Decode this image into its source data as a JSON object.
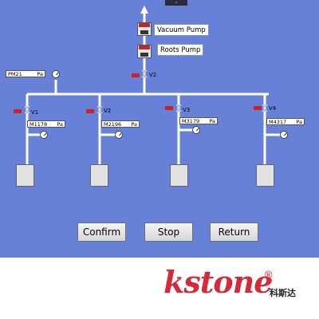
{
  "top_tab": "⌄",
  "pumps": {
    "vacuum_label": "Vacuum Pump",
    "roots_label": "Roots Pump"
  },
  "main_gauge": {
    "value": "PM21",
    "unit": "Pa"
  },
  "valve_v2_top": "V2",
  "branches": [
    {
      "valve": "V1",
      "readout": "M1",
      "value": "178",
      "unit": "Pa"
    },
    {
      "valve": "V2",
      "readout": "M2",
      "value": "196",
      "unit": "Pa"
    },
    {
      "valve": "V3",
      "readout": "M3",
      "value": "179",
      "unit": "Pa"
    },
    {
      "valve": "V4",
      "readout": "M4",
      "value": "317",
      "unit": "Pa"
    }
  ],
  "buttons": {
    "confirm": "Confirm",
    "stop": "Stop",
    "return": "Return"
  },
  "logo": {
    "word": "kstone",
    "reg": "®",
    "cn": "科斯达"
  },
  "colors": {
    "background": "#6780d8",
    "pipe": "#ffffff",
    "brand": "#d42a3a",
    "valve_tag": "#cc2222"
  }
}
